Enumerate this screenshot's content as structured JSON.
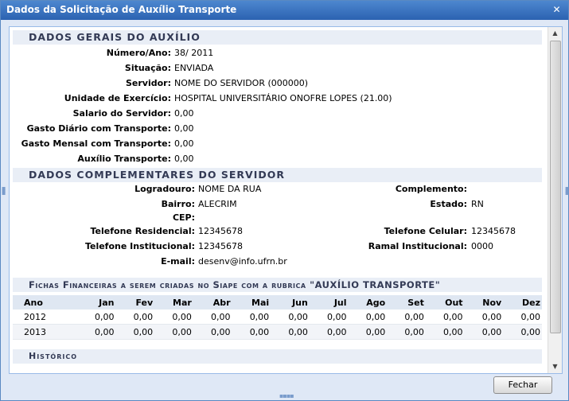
{
  "window": {
    "title": "Dados da Solicitação de Auxílio Transporte",
    "close_symbol": "✕"
  },
  "geral": {
    "heading": "DADOS GERAIS DO AUXÍLIO",
    "fields": [
      {
        "label": "Número/Ano:",
        "value": "38/ 2011"
      },
      {
        "label": "Situação:",
        "value": "ENVIADA"
      },
      {
        "label": "Servidor:",
        "value": "NOME DO SERVIDOR (000000)"
      },
      {
        "label": "Unidade de Exercício:",
        "value": "HOSPITAL UNIVERSITÁRIO ONOFRE LOPES (21.00)"
      },
      {
        "label": "Salario do Servidor:",
        "value": "0,00"
      },
      {
        "label": "Gasto Diário com Transporte:",
        "value": "0,00"
      },
      {
        "label": "Gasto Mensal com Transporte:",
        "value": "0,00"
      },
      {
        "label": "Auxílio Transporte:",
        "value": "0,00"
      }
    ]
  },
  "complementares": {
    "heading": "DADOS COMPLEMENTARES DO SERVIDOR",
    "left": [
      {
        "label": "Logradouro:",
        "value": "NOME DA RUA"
      },
      {
        "label": "Bairro:",
        "value": "ALECRIM"
      },
      {
        "label": "CEP:",
        "value": ""
      },
      {
        "label": "Telefone Residencial:",
        "value": "12345678"
      },
      {
        "label": "Telefone Institucional:",
        "value": "12345678"
      },
      {
        "label": "E-mail:",
        "value": "desenv@info.ufrn.br"
      }
    ],
    "right": [
      {
        "label": "Complemento:",
        "value": ""
      },
      {
        "label": "Estado:",
        "value": "RN"
      },
      {
        "label": "",
        "value": ""
      },
      {
        "label": "Telefone Celular:",
        "value": "12345678"
      },
      {
        "label": "Ramal Institucional:",
        "value": "0000"
      }
    ]
  },
  "fichas": {
    "heading": "Fichas Financeiras a serem criadas no Siape com a rubrica \"AUXÍLIO TRANSPORTE\"",
    "columns": [
      "Ano",
      "Jan",
      "Fev",
      "Mar",
      "Abr",
      "Mai",
      "Jun",
      "Jul",
      "Ago",
      "Set",
      "Out",
      "Nov",
      "Dez"
    ],
    "rows": [
      [
        "2012",
        "0,00",
        "0,00",
        "0,00",
        "0,00",
        "0,00",
        "0,00",
        "0,00",
        "0,00",
        "0,00",
        "0,00",
        "0,00",
        "0,00"
      ],
      [
        "2013",
        "0,00",
        "0,00",
        "0,00",
        "0,00",
        "0,00",
        "0,00",
        "0,00",
        "0,00",
        "0,00",
        "0,00",
        "0,00",
        "0,00"
      ]
    ]
  },
  "historico": {
    "heading": "Histórico"
  },
  "buttons": {
    "close_label": "Fechar"
  },
  "scroll": {
    "up_symbol": "▲",
    "down_symbol": "▼"
  }
}
